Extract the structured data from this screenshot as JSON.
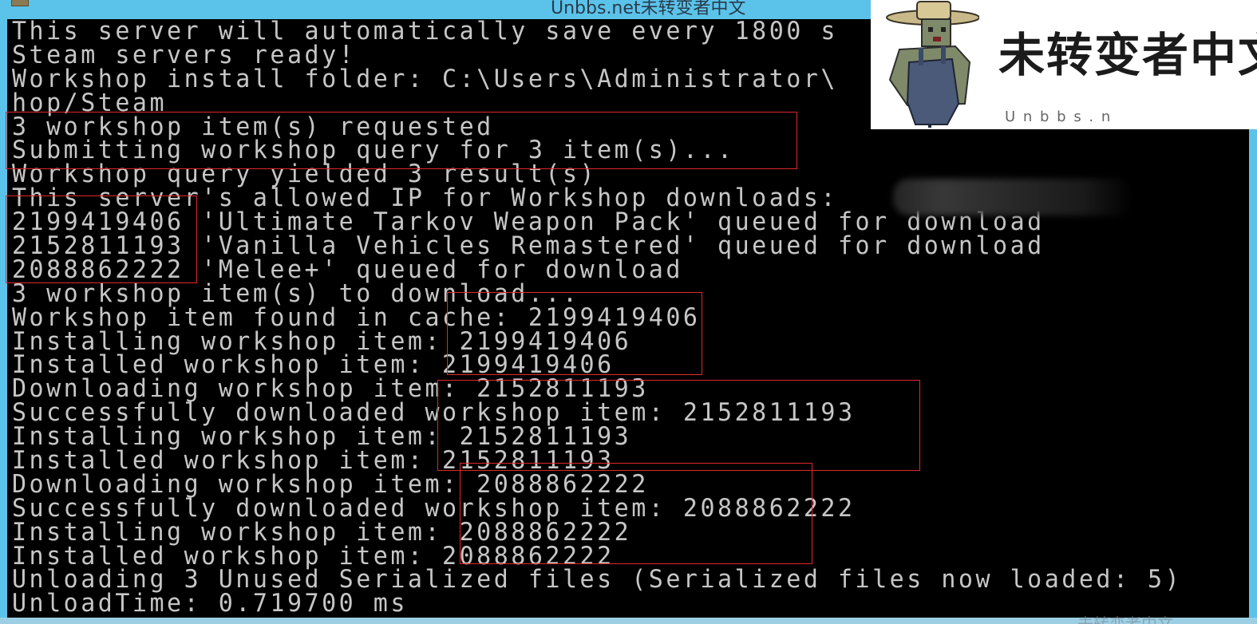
{
  "window": {
    "title": "Unbbs.net未转变者中文"
  },
  "console": {
    "lines": [
      "This server will automatically save every 1800 s",
      "Steam servers ready!",
      "Workshop install folder: C:\\Users\\Administrator\\",
      "hop/Steam",
      "3 workshop item(s) requested",
      "Submitting workshop query for 3 item(s)...",
      "Workshop query yielded 3 result(s)",
      "This server's allowed IP for Workshop downloads:",
      "2199419406 'Ultimate Tarkov Weapon Pack' queued for download",
      "2152811193 'Vanilla Vehicles Remastered' queued for download",
      "2088862222 'Melee+' queued for download",
      "3 workshop item(s) to download...",
      "Workshop item found in cache: 2199419406",
      "Installing workshop item: 2199419406",
      "Installed workshop item: 2199419406",
      "Downloading workshop item: 2152811193",
      "Successfully downloaded workshop item: 2152811193",
      "Installing workshop item: 2152811193",
      "Installed workshop item: 2152811193",
      "Downloading workshop item: 2088862222",
      "Successfully downloaded workshop item: 2088862222",
      "Installing workshop item: 2088862222",
      "Installed workshop item: 2088862222",
      "Unloading 3 Unused Serialized files (Serialized files now loaded: 5)",
      "UnloadTime: 0.719700 ms"
    ]
  },
  "watermark": {
    "title": "未转变者中文",
    "subtitle": "U n b b s . n"
  },
  "colors": {
    "console_bg": "#000000",
    "console_text": "#c6c6c6",
    "annotation": "#e0282c",
    "window_bg": "#5bc3ea"
  }
}
